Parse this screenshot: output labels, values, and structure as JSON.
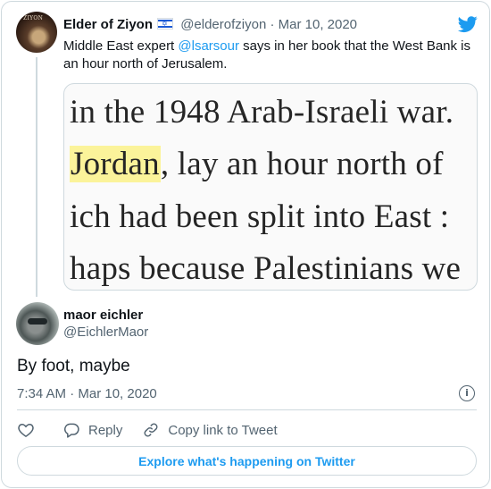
{
  "parent_tweet": {
    "author_name": "Elder of Ziyon",
    "flag_icon": "israel-flag-icon",
    "handle": "@elderofziyon",
    "separator": "·",
    "date": "Mar 10, 2020",
    "text_prefix": "Middle East expert ",
    "mention": "@lsarsour",
    "text_suffix": " says in her book that the West Bank is an hour north of Jerusalem.",
    "avatar_text": "ZIYON",
    "image_lines": [
      "in the 1948 Arab-Israeli war.",
      "Jordan",
      ", lay an hour north of",
      "ich had been split into East :",
      "haps because Palestinians we"
    ]
  },
  "reply_tweet": {
    "author_name": "maor eichler",
    "handle": "@EichlerMaor",
    "text": "By foot, maybe",
    "timestamp": "7:34 AM · Mar 10, 2020"
  },
  "actions": {
    "reply_label": "Reply",
    "copy_label": "Copy link to Tweet"
  },
  "explore_label": "Explore what's happening on Twitter",
  "colors": {
    "accent": "#1d9bf0",
    "text": "#0f1419",
    "secondary": "#536471",
    "border": "#cfd9de",
    "highlight": "#fbf39a"
  }
}
